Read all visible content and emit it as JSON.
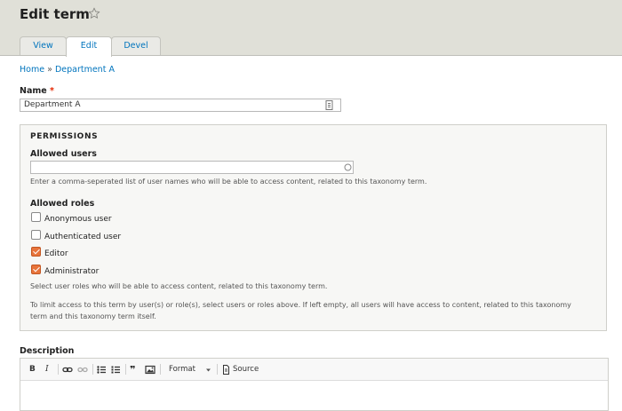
{
  "page": {
    "title": "Edit term"
  },
  "tabs": [
    {
      "label": "View"
    },
    {
      "label": "Edit",
      "active": true
    },
    {
      "label": "Devel"
    }
  ],
  "breadcrumb": {
    "home": "Home",
    "separator": "»",
    "current": "Department A"
  },
  "name_field": {
    "label": "Name",
    "required_marker": "*",
    "value": "Department A"
  },
  "permissions": {
    "legend": "PERMISSIONS",
    "allowed_users": {
      "label": "Allowed users",
      "value": "",
      "description": "Enter a comma-seperated list of user names who will be able to access content, related to this taxonomy term."
    },
    "allowed_roles": {
      "label": "Allowed roles",
      "options": [
        {
          "label": "Anonymous user",
          "checked": false
        },
        {
          "label": "Authenticated user",
          "checked": false
        },
        {
          "label": "Editor",
          "checked": true
        },
        {
          "label": "Administrator",
          "checked": true
        }
      ],
      "description": "Select user roles who will be able to access content, related to this taxonomy term."
    },
    "help_text": "To limit access to this term by user(s) or role(s), select users or roles above. If left empty, all users will have access to content, related to this taxonomy term and this taxonomy term itself."
  },
  "description_field": {
    "label": "Description",
    "toolbar": {
      "bold": "B",
      "italic": "I",
      "blockquote": "❞",
      "format_label": "Format",
      "source_label": "Source"
    }
  },
  "colors": {
    "link": "#0074bd",
    "header_bg": "#e0e0d8",
    "checkbox_checked": "#e8743b",
    "required": "#e62600"
  }
}
